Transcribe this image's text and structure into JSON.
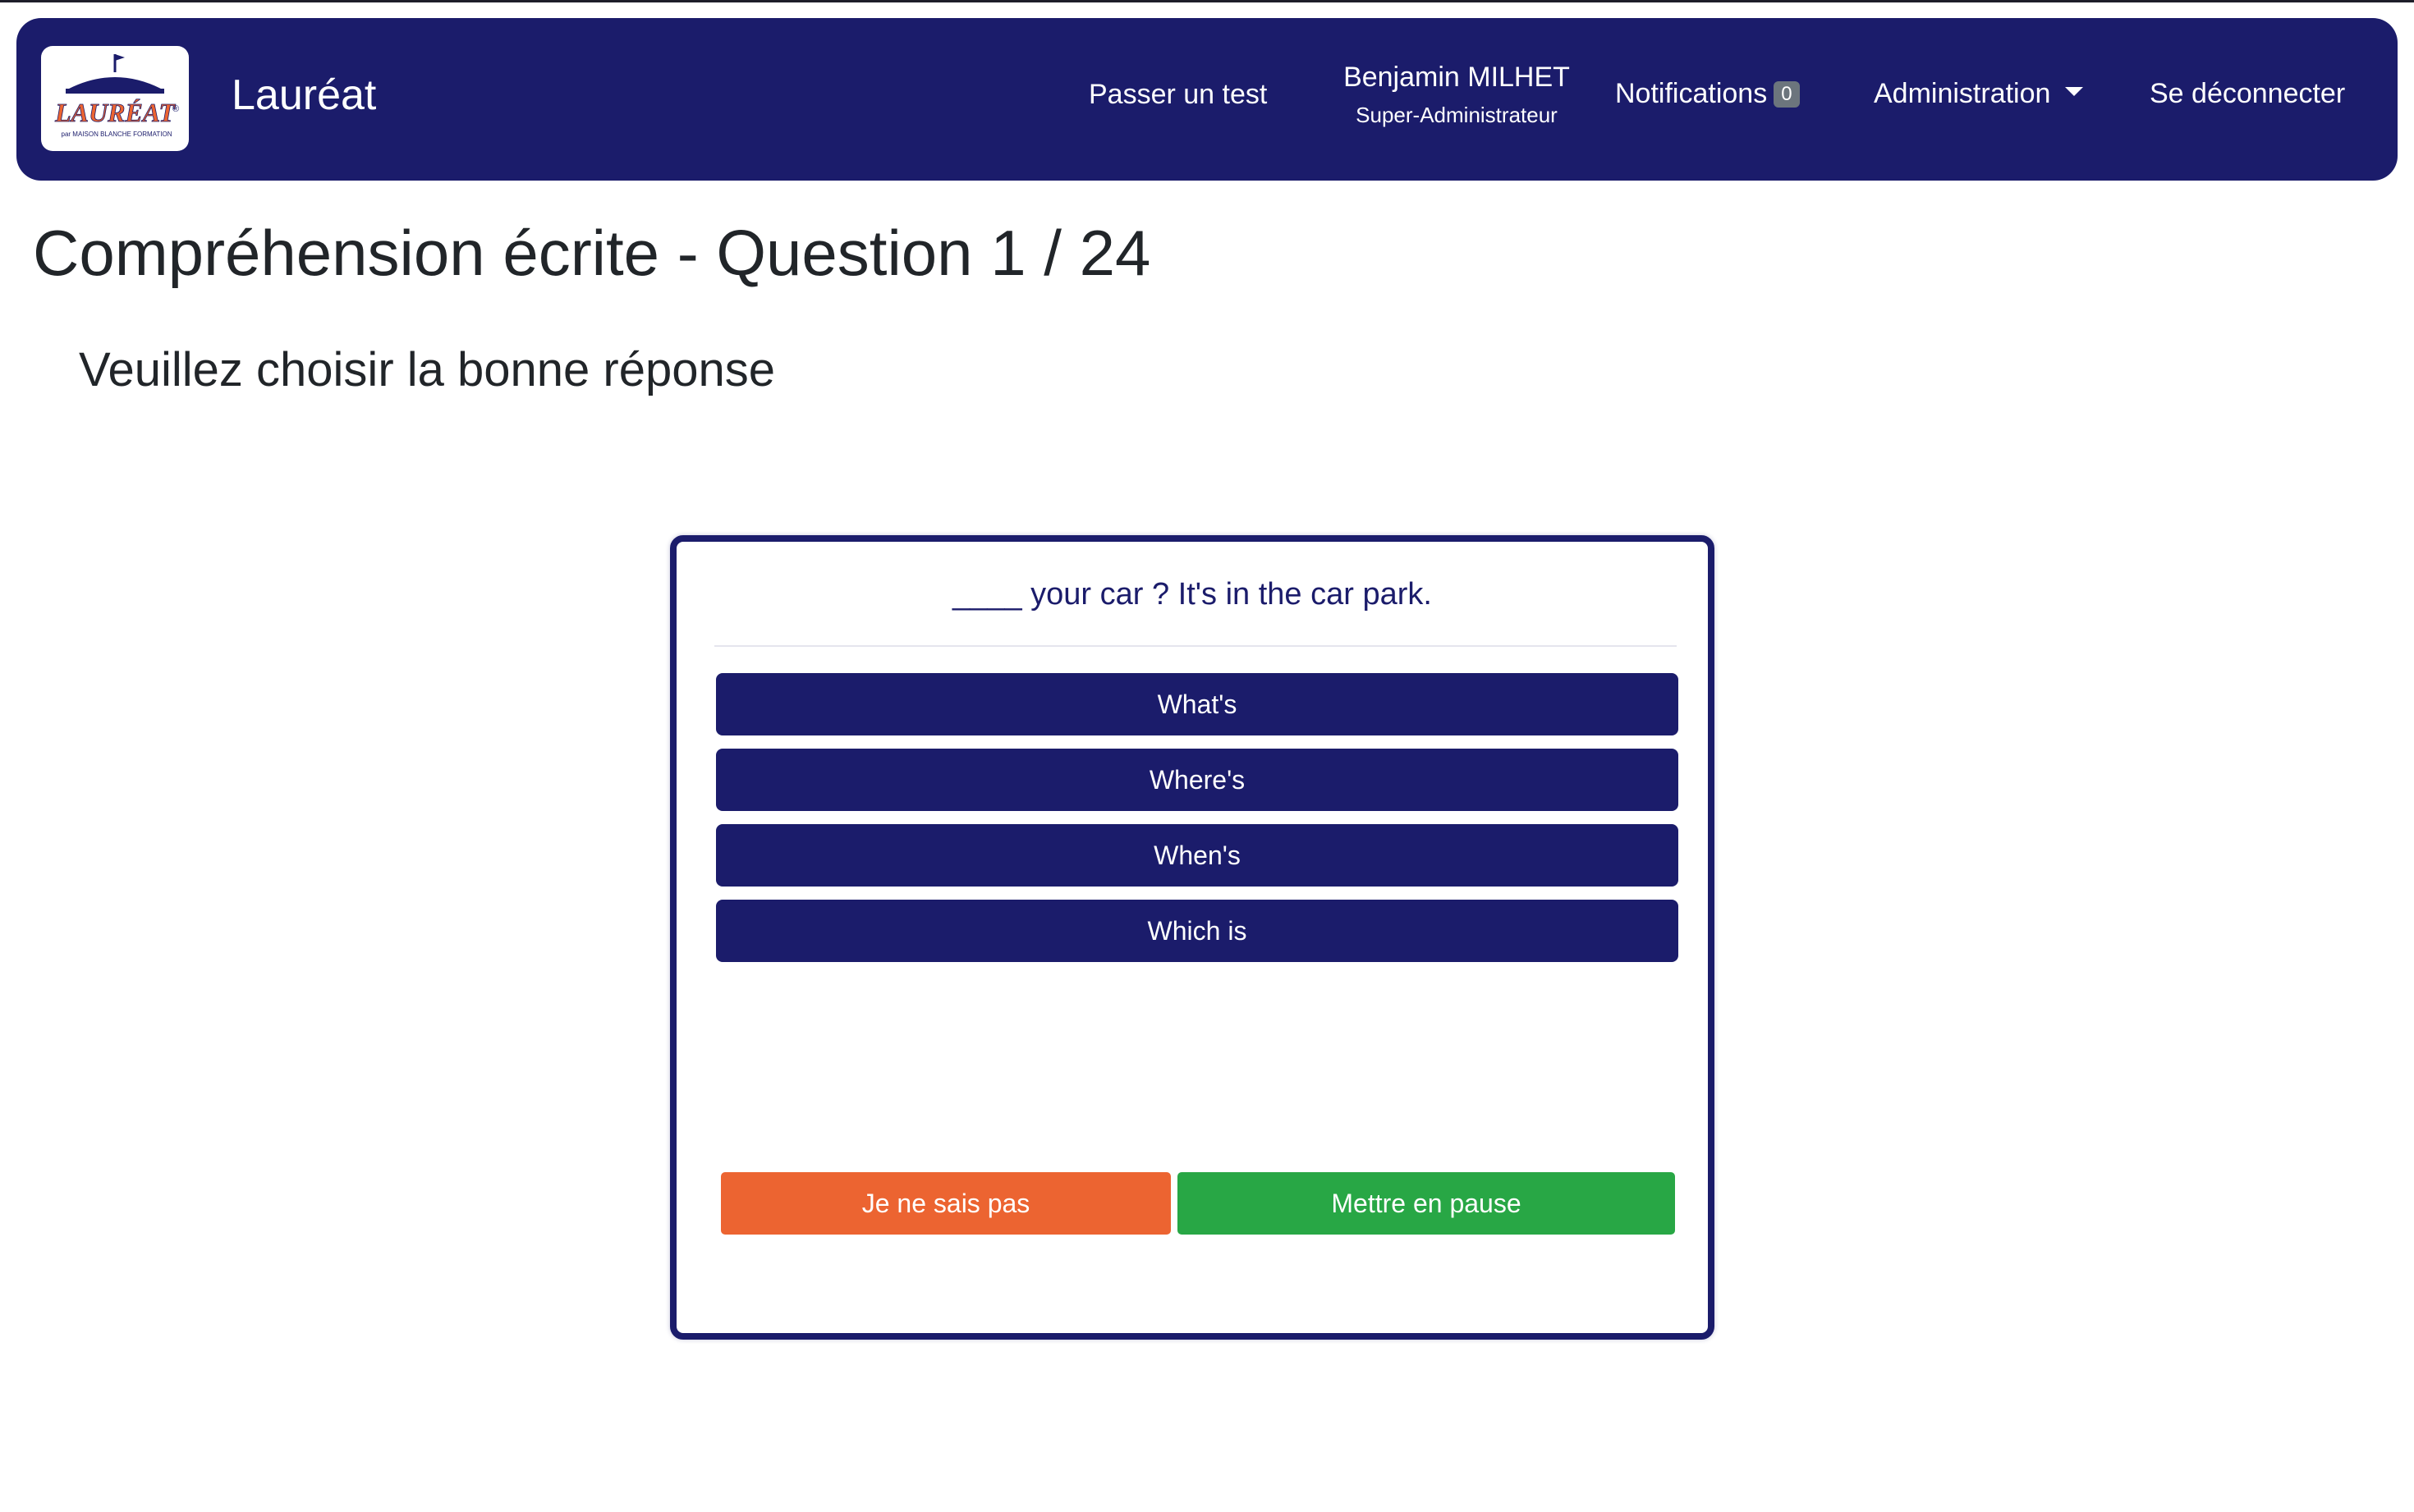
{
  "navbar": {
    "brand": "Lauréat",
    "logo": {
      "wordmark": "LAURÉAT",
      "registered": "®",
      "tagline": "par MAISON BLANCHE FORMATION",
      "icon": "flag-roof-icon"
    },
    "links": {
      "take_test": "Passer un test",
      "user_name": "Benjamin MILHET",
      "user_role": "Super-Administrateur",
      "notifications": "Notifications",
      "notifications_count": "0",
      "administration": "Administration",
      "logout": "Se déconnecter"
    },
    "colors": {
      "background": "#1b1c6b",
      "text": "#ffffff",
      "logo_accent": "#ec6431"
    }
  },
  "page": {
    "title": "Compréhension écrite - Question 1 / 24",
    "instruction": "Veuillez choisir la bonne réponse"
  },
  "question": {
    "text": "____ your car ? It's in the car park.",
    "answers": [
      "What's",
      "Where's",
      "When's",
      "Which is"
    ]
  },
  "actions": {
    "skip": "Je ne sais pas",
    "pause": "Mettre en pause",
    "colors": {
      "skip": "#ec6431",
      "pause": "#28a745",
      "answer": "#1b1c6b"
    }
  }
}
